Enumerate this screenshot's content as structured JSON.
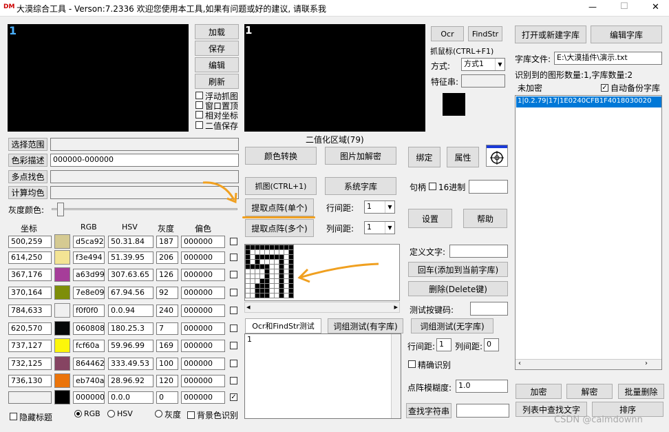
{
  "window": {
    "icon_text": "DM",
    "title": "大漠综合工具 -  Verson:7.2336  欢迎您使用本工具,如果有问题或好的建议, 请联系我",
    "min": "—",
    "max": "☐",
    "close": "✕"
  },
  "left_preview": {
    "label": "1"
  },
  "left_buttons": {
    "load": "加载",
    "save": "保存",
    "edit": "编辑",
    "refresh": "刷新"
  },
  "left_checks": {
    "float_grab": "浮动抓图",
    "window_top": "窗口置顶",
    "relative_coord": "相对坐标",
    "binary_save": "二值保存"
  },
  "left_fields": {
    "select_range": "选择范围",
    "color_desc": "色彩描述",
    "color_desc_value": "000000-000000",
    "multi_pick": "多点找色",
    "calc_avg": "计算均色",
    "gray_color": "灰度颜色:"
  },
  "color_table": {
    "headers": [
      "坐标",
      "RGB",
      "HSV",
      "灰度",
      "偏色"
    ],
    "rows": [
      {
        "coord": "500,259",
        "color": "#d5ca92",
        "rgb": "d5ca92",
        "hsv": "50.31.84",
        "gray": "187",
        "offset": "000000",
        "checked": false
      },
      {
        "coord": "614,250",
        "color": "#f3e494",
        "rgb": "f3e494",
        "hsv": "51.39.95",
        "gray": "206",
        "offset": "000000",
        "checked": false
      },
      {
        "coord": "367,176",
        "color": "#a63d99",
        "rgb": "a63d99",
        "hsv": "307.63.65",
        "gray": "126",
        "offset": "000000",
        "checked": false
      },
      {
        "coord": "370,164",
        "color": "#7e8e09",
        "rgb": "7e8e09",
        "hsv": "67.94.56",
        "gray": "92",
        "offset": "000000",
        "checked": false
      },
      {
        "coord": "784,633",
        "color": "#f0f0f0",
        "rgb": "f0f0f0",
        "hsv": "0.0.94",
        "gray": "240",
        "offset": "000000",
        "checked": false
      },
      {
        "coord": "620,570",
        "color": "#060808",
        "rgb": "060808",
        "hsv": "180.25.3",
        "gray": "7",
        "offset": "000000",
        "checked": false
      },
      {
        "coord": "737,127",
        "color": "#fcf60a",
        "rgb": "fcf60a",
        "hsv": "59.96.99",
        "gray": "169",
        "offset": "000000",
        "checked": false
      },
      {
        "coord": "732,125",
        "color": "#864462",
        "rgb": "864462",
        "hsv": "333.49.53",
        "gray": "100",
        "offset": "000000",
        "checked": false
      },
      {
        "coord": "736,130",
        "color": "#eb740a",
        "rgb": "eb740a",
        "hsv": "28.96.92",
        "gray": "120",
        "offset": "000000",
        "checked": false
      },
      {
        "coord": "",
        "color": "#000000",
        "rgb": "000000",
        "hsv": "0.0.0",
        "gray": "0",
        "offset": "000000",
        "checked": true
      }
    ]
  },
  "bottom_left": {
    "hide_title": "隐藏标题",
    "rgb": "RGB",
    "hsv": "HSV",
    "gray": "灰度",
    "bg_detect": "背景色识别"
  },
  "middle": {
    "preview_label": "1",
    "binary_area": "二值化区域(79)",
    "color_convert": "颜色转换",
    "img_decrypt": "图片加解密",
    "grab": "抓图(CTRL+1)",
    "sys_lib": "系统字库",
    "extract_single": "提取点阵(单个)",
    "extract_multi": "提取点阵(多个)",
    "row_spacing": "行间距:",
    "col_spacing": "列间距:",
    "row_val": "1",
    "col_val": "1",
    "tab_ocr": "Ocr和FindStr测试",
    "tab_group_lib": "词组测试(有字库)",
    "tab_group_nolib": "词组测试(无字库)",
    "test_text": "1",
    "left_arrow": "◂",
    "right_arrow": "▸"
  },
  "ocr_panel": {
    "ocr": "Ocr",
    "findstr": "FindStr",
    "grab_mouse": "抓鼠标(CTRL+F1)",
    "mode": "方式:",
    "mode_val": "方式1",
    "feature": "特征串:"
  },
  "middle_right": {
    "bind": "绑定",
    "attr": "属性",
    "handle": "句柄",
    "hex": "16进制",
    "settings": "设置",
    "help": "帮助",
    "define_text": "定义文字:",
    "enter_add": "回车(添加到当前字库)",
    "delete_key": "删除(Delete键)",
    "test_keycode": "测试按键码:",
    "row_spacing": "行间距:",
    "col_spacing": "列间距:",
    "row_val": "1",
    "col_val": "0",
    "exact": "精确识别",
    "fuzzy": "点阵模糊度:",
    "fuzzy_val": "1.0",
    "find_str": "查找字符串"
  },
  "right": {
    "open_lib": "打开或新建字库",
    "edit_lib": "编辑字库",
    "lib_file": "字库文件:",
    "lib_path": "E:\\大漠插件\\演示.txt",
    "count": "识别到的图形数量:1,字库数量:2",
    "not_encrypted": "未加密",
    "auto_backup": "自动备份字库",
    "list_item": "1|0.2.79|17|1E0240CFB1F4018030020",
    "encrypt": "加密",
    "decrypt": "解密",
    "batch_delete": "批量删除",
    "list_find": "列表中查找文字",
    "sort": "排序"
  },
  "watermark": "CSDN @calmdownn"
}
